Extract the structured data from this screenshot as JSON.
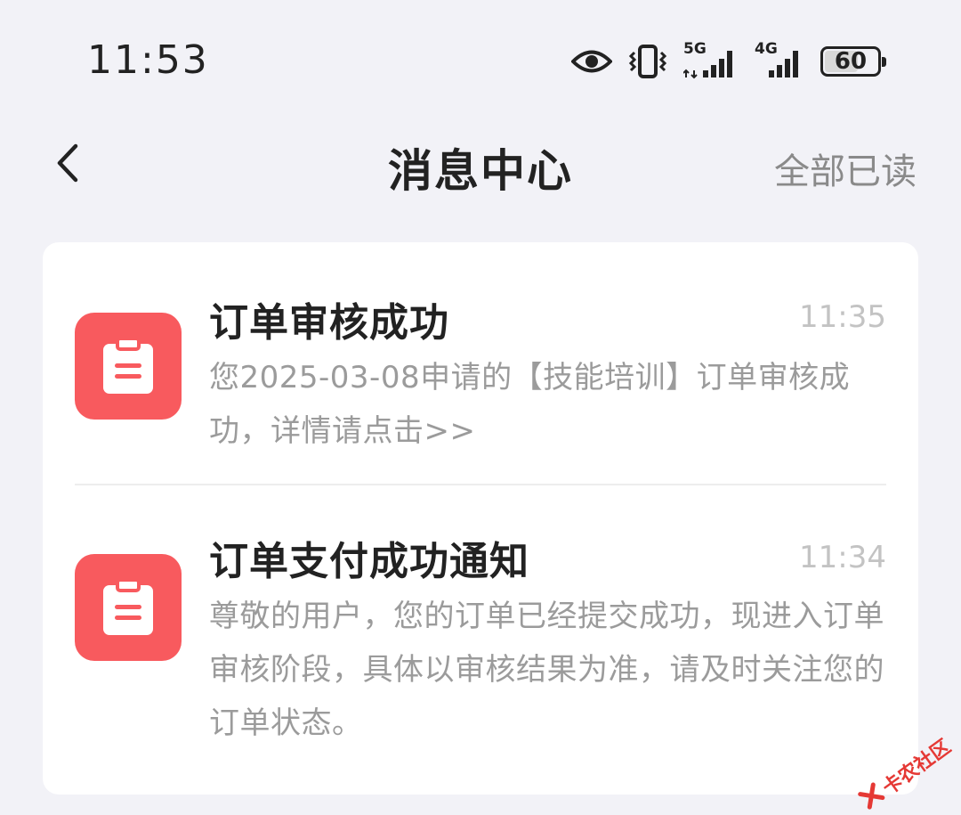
{
  "status_bar": {
    "time": "11:53",
    "net1_label": "5G",
    "net2_label": "4G",
    "battery_level": "60",
    "icons": [
      "eye-icon",
      "vibrate-icon",
      "signal-5g-icon",
      "signal-4g-icon",
      "battery-icon"
    ]
  },
  "nav": {
    "title": "消息中心",
    "mark_all_read": "全部已读",
    "back_icon": "chevron-left-icon"
  },
  "messages": [
    {
      "title": "订单审核成功",
      "time": "11:35",
      "body": "您2025-03-08申请的【技能培训】订单审核成功，详情请点击>>",
      "icon": "clipboard-icon"
    },
    {
      "title": "订单支付成功通知",
      "time": "11:34",
      "body": "尊敬的用户，您的订单已经提交成功，现进入订单审核阶段，具体以审核结果为准，请及时关注您的订单状态。",
      "icon": "clipboard-icon"
    }
  ],
  "watermark": {
    "text": "卡农社区"
  },
  "colors": {
    "background": "#f2f2f7",
    "icon_red": "#f85a5e",
    "title_text": "#222222",
    "secondary_text": "#9b9b9b",
    "time_text": "#c3c3c3",
    "watermark_red": "#e53935"
  }
}
